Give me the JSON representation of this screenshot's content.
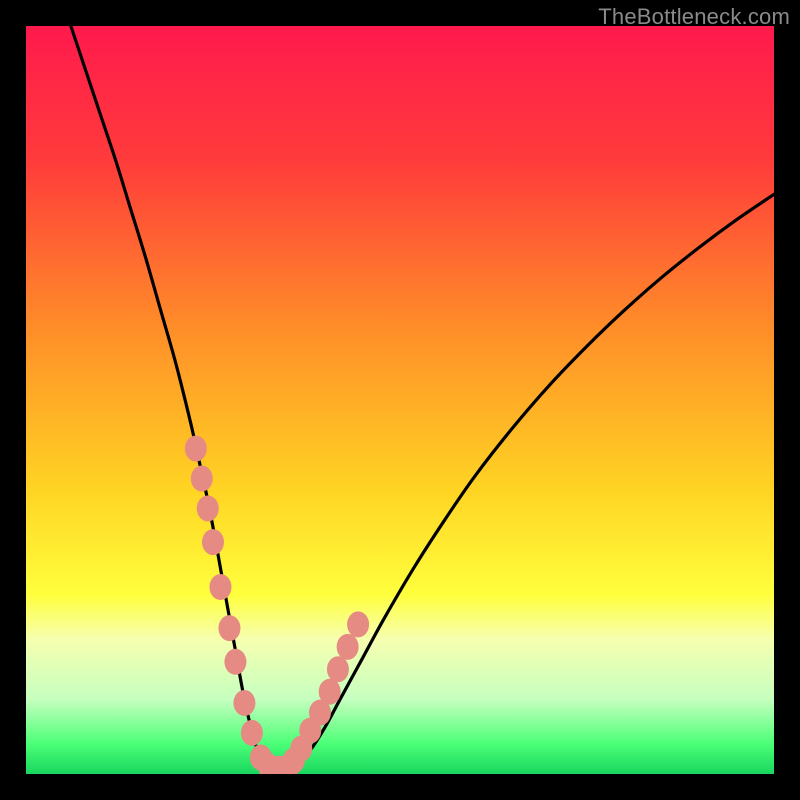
{
  "watermark": "TheBottleneck.com",
  "gradient": {
    "stops": [
      {
        "offset": 0.0,
        "color": "#ff1a4d"
      },
      {
        "offset": 0.18,
        "color": "#ff3b3b"
      },
      {
        "offset": 0.4,
        "color": "#ff8c29"
      },
      {
        "offset": 0.62,
        "color": "#ffd423"
      },
      {
        "offset": 0.76,
        "color": "#ffff3d"
      },
      {
        "offset": 0.82,
        "color": "#f6ffb0"
      },
      {
        "offset": 0.9,
        "color": "#c6ffbf"
      },
      {
        "offset": 0.96,
        "color": "#4bff77"
      },
      {
        "offset": 1.0,
        "color": "#18d65d"
      }
    ]
  },
  "curve_style": {
    "stroke": "#000000",
    "stroke_width": 3.2
  },
  "marker_style": {
    "fill": "#e58b84",
    "rx": 11,
    "ry": 13
  },
  "chart_data": {
    "type": "line",
    "title": "",
    "xlabel": "",
    "ylabel": "",
    "xlim": [
      0,
      100
    ],
    "ylim": [
      0,
      100
    ],
    "grid": false,
    "series": [
      {
        "name": "bottleneck-curve",
        "x": [
          6,
          8,
          10,
          12,
          14,
          16,
          18,
          20,
          22,
          23,
          24,
          25,
          26,
          27,
          28,
          29,
          30,
          31,
          32,
          33,
          34,
          35,
          36,
          38,
          40,
          42,
          45,
          48,
          52,
          56,
          60,
          65,
          70,
          75,
          80,
          85,
          90,
          95,
          100
        ],
        "y": [
          100,
          94,
          88,
          82,
          75.5,
          69,
          62,
          55,
          47,
          42.5,
          38,
          33,
          27.5,
          22,
          16.5,
          11,
          6.5,
          3,
          1.2,
          0.6,
          0.5,
          0.7,
          1.3,
          3.2,
          6.3,
          10,
          15.5,
          21,
          27.8,
          34,
          39.8,
          46.2,
          52,
          57.2,
          62,
          66.4,
          70.4,
          74.1,
          77.5
        ]
      }
    ],
    "markers": {
      "name": "highlighted-points",
      "x": [
        22.7,
        23.5,
        24.3,
        25.0,
        26.0,
        27.2,
        28.0,
        29.2,
        30.2,
        31.4,
        32.5,
        33.8,
        35.0,
        35.8,
        36.8,
        38.0,
        39.3,
        40.6,
        41.7,
        43.0,
        44.4
      ],
      "y": [
        43.5,
        39.5,
        35.5,
        31.0,
        25.0,
        19.5,
        15.0,
        9.5,
        5.5,
        2.2,
        1.0,
        0.7,
        0.9,
        1.8,
        3.4,
        5.8,
        8.2,
        11.0,
        14.0,
        17.0,
        20.0
      ]
    }
  }
}
